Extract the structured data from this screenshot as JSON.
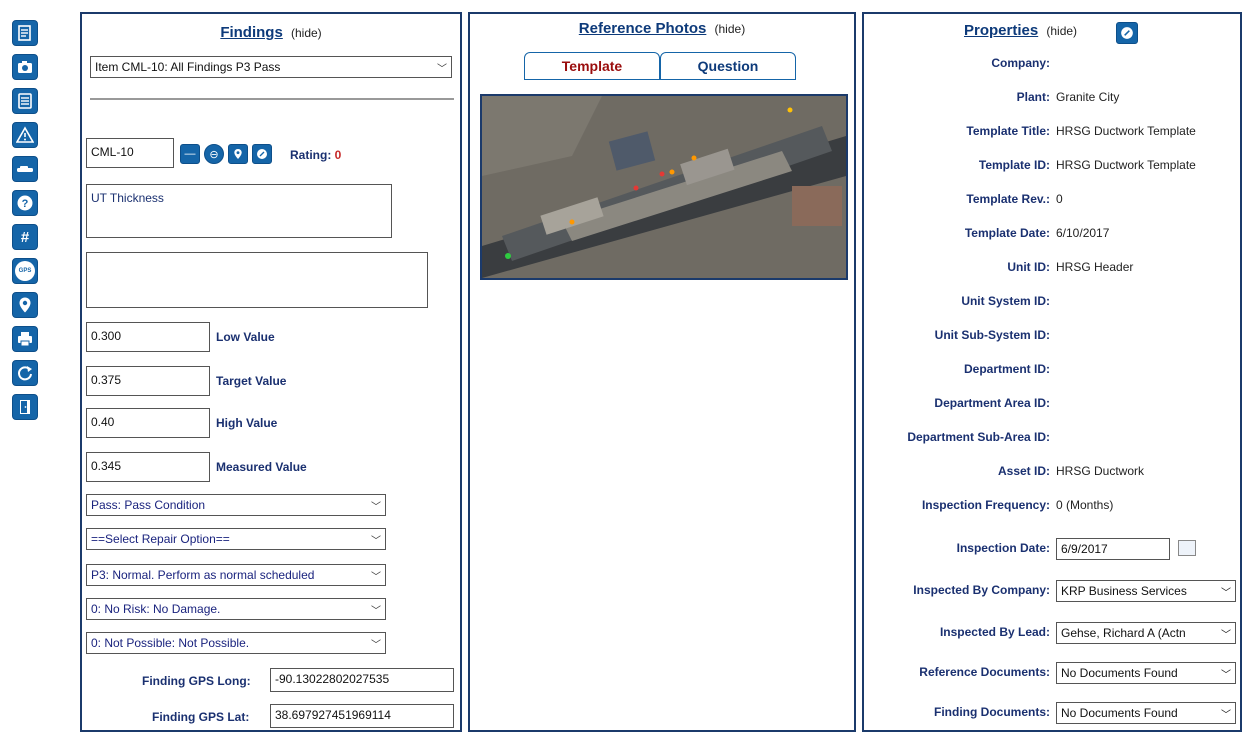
{
  "toolbar": {
    "icons": [
      "document-icon",
      "camera-icon",
      "list-icon",
      "warning-icon",
      "car-icon",
      "help-icon",
      "hash-icon",
      "gps-icon",
      "location-pin-icon",
      "print-icon",
      "refresh-icon",
      "exit-door-icon"
    ],
    "gps_text": "GPS"
  },
  "findings": {
    "title": "Findings",
    "hide": "(hide)",
    "item_select": "Item CML-10: All Findings P3 Pass",
    "cml_value": "CML-10",
    "rating_label": "Rating:",
    "rating_value": "0",
    "description": "UT Thickness",
    "notes": "",
    "low_value": "0.300",
    "low_label": "Low Value",
    "target_value": "0.375",
    "target_label": "Target Value",
    "high_value": "0.40",
    "high_label": "High Value",
    "measured_value": "0.345",
    "measured_label": "Measured Value",
    "condition_select": "Pass: Pass Condition",
    "repair_select": "==Select Repair Option==",
    "priority_select": "P3: Normal. Perform as normal scheduled",
    "risk_select": "0: No Risk: No Damage.",
    "possibility_select": "0: Not Possible: Not Possible.",
    "gps_long_label": "Finding GPS Long:",
    "gps_long_value": "-90.13022802027535",
    "gps_lat_label": "Finding GPS Lat:",
    "gps_lat_value": "38.697927451969114"
  },
  "reference": {
    "title": "Reference Photos",
    "hide": "(hide)",
    "tab_template": "Template",
    "tab_question": "Question"
  },
  "properties": {
    "title": "Properties",
    "hide": "(hide)",
    "company_label": "Company:",
    "company_value": "",
    "plant_label": "Plant:",
    "plant_value": "Granite City",
    "template_title_label": "Template Title:",
    "template_title_value": "HRSG Ductwork Template",
    "template_id_label": "Template ID:",
    "template_id_value": "HRSG Ductwork Template",
    "template_rev_label": "Template Rev.:",
    "template_rev_value": "0",
    "template_date_label": "Template Date:",
    "template_date_value": "6/10/2017",
    "unit_id_label": "Unit ID:",
    "unit_id_value": "HRSG Header",
    "unit_system_label": "Unit System ID:",
    "unit_subsystem_label": "Unit Sub-System ID:",
    "department_label": "Department ID:",
    "department_area_label": "Department Area ID:",
    "department_subarea_label": "Department Sub-Area ID:",
    "asset_id_label": "Asset ID:",
    "asset_id_value": "HRSG Ductwork",
    "inspection_freq_label": "Inspection Frequency:",
    "inspection_freq_value": "0 (Months)",
    "inspection_date_label": "Inspection Date:",
    "inspection_date_value": "6/9/2017",
    "inspected_company_label": "Inspected By Company:",
    "inspected_company_value": "KRP Business Services",
    "inspected_lead_label": "Inspected By Lead:",
    "inspected_lead_value": "Gehse, Richard A (Actn",
    "reference_docs_label": "Reference Documents:",
    "reference_docs_value": "No Documents Found",
    "finding_docs_label": "Finding Documents:",
    "finding_docs_value": "No Documents Found"
  },
  "colors": {
    "accent": "#1565a8",
    "label_blue": "#1a3070",
    "rating_red": "#c62828",
    "tab_active_red": "#9a0d0d"
  }
}
